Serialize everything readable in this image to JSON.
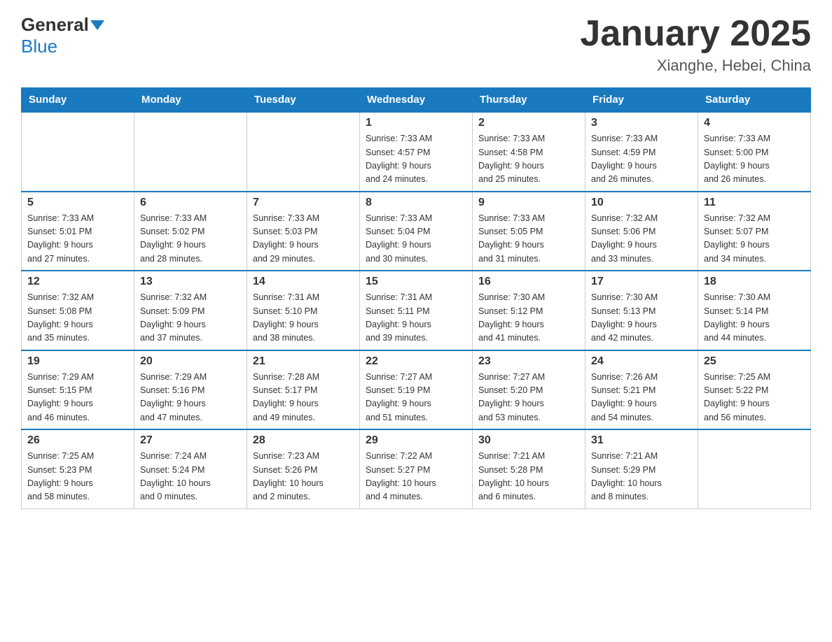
{
  "header": {
    "logo_general": "General",
    "logo_blue": "Blue",
    "title": "January 2025",
    "location": "Xianghe, Hebei, China"
  },
  "days_of_week": [
    "Sunday",
    "Monday",
    "Tuesday",
    "Wednesday",
    "Thursday",
    "Friday",
    "Saturday"
  ],
  "weeks": [
    [
      {
        "day": "",
        "info": ""
      },
      {
        "day": "",
        "info": ""
      },
      {
        "day": "",
        "info": ""
      },
      {
        "day": "1",
        "info": "Sunrise: 7:33 AM\nSunset: 4:57 PM\nDaylight: 9 hours\nand 24 minutes."
      },
      {
        "day": "2",
        "info": "Sunrise: 7:33 AM\nSunset: 4:58 PM\nDaylight: 9 hours\nand 25 minutes."
      },
      {
        "day": "3",
        "info": "Sunrise: 7:33 AM\nSunset: 4:59 PM\nDaylight: 9 hours\nand 26 minutes."
      },
      {
        "day": "4",
        "info": "Sunrise: 7:33 AM\nSunset: 5:00 PM\nDaylight: 9 hours\nand 26 minutes."
      }
    ],
    [
      {
        "day": "5",
        "info": "Sunrise: 7:33 AM\nSunset: 5:01 PM\nDaylight: 9 hours\nand 27 minutes."
      },
      {
        "day": "6",
        "info": "Sunrise: 7:33 AM\nSunset: 5:02 PM\nDaylight: 9 hours\nand 28 minutes."
      },
      {
        "day": "7",
        "info": "Sunrise: 7:33 AM\nSunset: 5:03 PM\nDaylight: 9 hours\nand 29 minutes."
      },
      {
        "day": "8",
        "info": "Sunrise: 7:33 AM\nSunset: 5:04 PM\nDaylight: 9 hours\nand 30 minutes."
      },
      {
        "day": "9",
        "info": "Sunrise: 7:33 AM\nSunset: 5:05 PM\nDaylight: 9 hours\nand 31 minutes."
      },
      {
        "day": "10",
        "info": "Sunrise: 7:32 AM\nSunset: 5:06 PM\nDaylight: 9 hours\nand 33 minutes."
      },
      {
        "day": "11",
        "info": "Sunrise: 7:32 AM\nSunset: 5:07 PM\nDaylight: 9 hours\nand 34 minutes."
      }
    ],
    [
      {
        "day": "12",
        "info": "Sunrise: 7:32 AM\nSunset: 5:08 PM\nDaylight: 9 hours\nand 35 minutes."
      },
      {
        "day": "13",
        "info": "Sunrise: 7:32 AM\nSunset: 5:09 PM\nDaylight: 9 hours\nand 37 minutes."
      },
      {
        "day": "14",
        "info": "Sunrise: 7:31 AM\nSunset: 5:10 PM\nDaylight: 9 hours\nand 38 minutes."
      },
      {
        "day": "15",
        "info": "Sunrise: 7:31 AM\nSunset: 5:11 PM\nDaylight: 9 hours\nand 39 minutes."
      },
      {
        "day": "16",
        "info": "Sunrise: 7:30 AM\nSunset: 5:12 PM\nDaylight: 9 hours\nand 41 minutes."
      },
      {
        "day": "17",
        "info": "Sunrise: 7:30 AM\nSunset: 5:13 PM\nDaylight: 9 hours\nand 42 minutes."
      },
      {
        "day": "18",
        "info": "Sunrise: 7:30 AM\nSunset: 5:14 PM\nDaylight: 9 hours\nand 44 minutes."
      }
    ],
    [
      {
        "day": "19",
        "info": "Sunrise: 7:29 AM\nSunset: 5:15 PM\nDaylight: 9 hours\nand 46 minutes."
      },
      {
        "day": "20",
        "info": "Sunrise: 7:29 AM\nSunset: 5:16 PM\nDaylight: 9 hours\nand 47 minutes."
      },
      {
        "day": "21",
        "info": "Sunrise: 7:28 AM\nSunset: 5:17 PM\nDaylight: 9 hours\nand 49 minutes."
      },
      {
        "day": "22",
        "info": "Sunrise: 7:27 AM\nSunset: 5:19 PM\nDaylight: 9 hours\nand 51 minutes."
      },
      {
        "day": "23",
        "info": "Sunrise: 7:27 AM\nSunset: 5:20 PM\nDaylight: 9 hours\nand 53 minutes."
      },
      {
        "day": "24",
        "info": "Sunrise: 7:26 AM\nSunset: 5:21 PM\nDaylight: 9 hours\nand 54 minutes."
      },
      {
        "day": "25",
        "info": "Sunrise: 7:25 AM\nSunset: 5:22 PM\nDaylight: 9 hours\nand 56 minutes."
      }
    ],
    [
      {
        "day": "26",
        "info": "Sunrise: 7:25 AM\nSunset: 5:23 PM\nDaylight: 9 hours\nand 58 minutes."
      },
      {
        "day": "27",
        "info": "Sunrise: 7:24 AM\nSunset: 5:24 PM\nDaylight: 10 hours\nand 0 minutes."
      },
      {
        "day": "28",
        "info": "Sunrise: 7:23 AM\nSunset: 5:26 PM\nDaylight: 10 hours\nand 2 minutes."
      },
      {
        "day": "29",
        "info": "Sunrise: 7:22 AM\nSunset: 5:27 PM\nDaylight: 10 hours\nand 4 minutes."
      },
      {
        "day": "30",
        "info": "Sunrise: 7:21 AM\nSunset: 5:28 PM\nDaylight: 10 hours\nand 6 minutes."
      },
      {
        "day": "31",
        "info": "Sunrise: 7:21 AM\nSunset: 5:29 PM\nDaylight: 10 hours\nand 8 minutes."
      },
      {
        "day": "",
        "info": ""
      }
    ]
  ]
}
